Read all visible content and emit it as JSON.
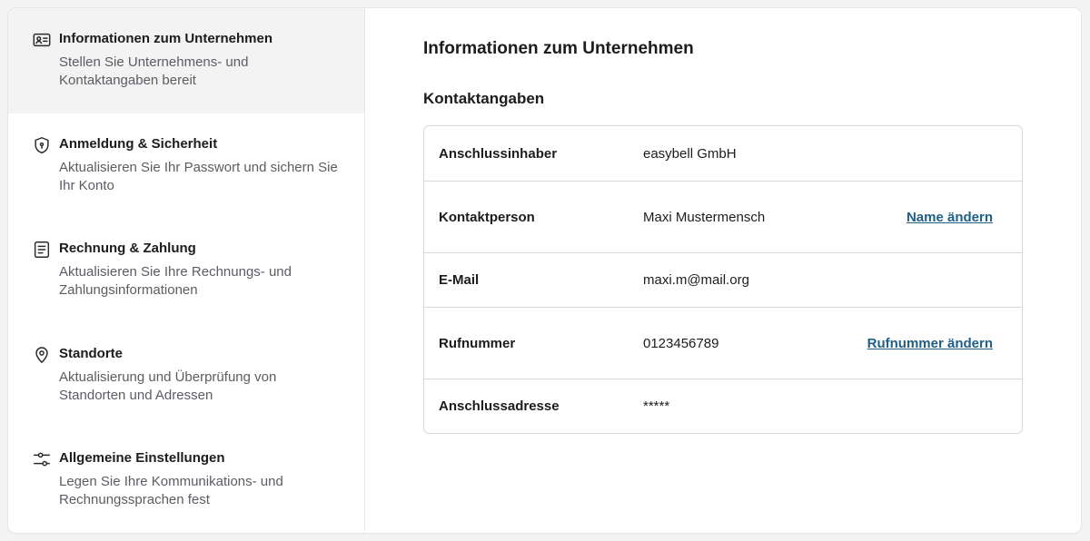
{
  "sidebar": {
    "items": [
      {
        "title": "Informationen zum Unternehmen",
        "description": "Stellen Sie Unternehmens- und Kontaktangaben bereit",
        "icon": "id-card-icon"
      },
      {
        "title": "Anmeldung & Sicherheit",
        "description": "Aktualisieren Sie Ihr Passwort und sichern Sie Ihr Konto",
        "icon": "shield-icon"
      },
      {
        "title": "Rechnung & Zahlung",
        "description": "Aktualisieren Sie Ihre Rechnungs- und Zahlungsinformationen",
        "icon": "invoice-icon"
      },
      {
        "title": "Standorte",
        "description": "Aktualisierung und Überprüfung von Standorten und Adressen",
        "icon": "location-pin-icon"
      },
      {
        "title": "Allgemeine Einstellungen",
        "description": "Legen Sie Ihre Kommunikations- und Rechnungssprachen fest",
        "icon": "sliders-icon"
      }
    ]
  },
  "main": {
    "title": "Informationen zum Unternehmen",
    "section_title": "Kontaktangaben",
    "rows": [
      {
        "label": "Anschlussinhaber",
        "value": "easybell GmbH",
        "action": ""
      },
      {
        "label": "Kontaktperson",
        "value": "Maxi Mustermensch",
        "action": "Name ändern"
      },
      {
        "label": "E-Mail",
        "value": "maxi.m@mail.org",
        "action": ""
      },
      {
        "label": "Rufnummer",
        "value": "0123456789",
        "action": "Rufnummer ändern"
      },
      {
        "label": "Anschlussadresse",
        "value": "*****",
        "action": ""
      }
    ]
  },
  "colors": {
    "active_nav_bg": "#f3f3f4",
    "link": "#1f5f86",
    "border": "#d9d9dc"
  }
}
